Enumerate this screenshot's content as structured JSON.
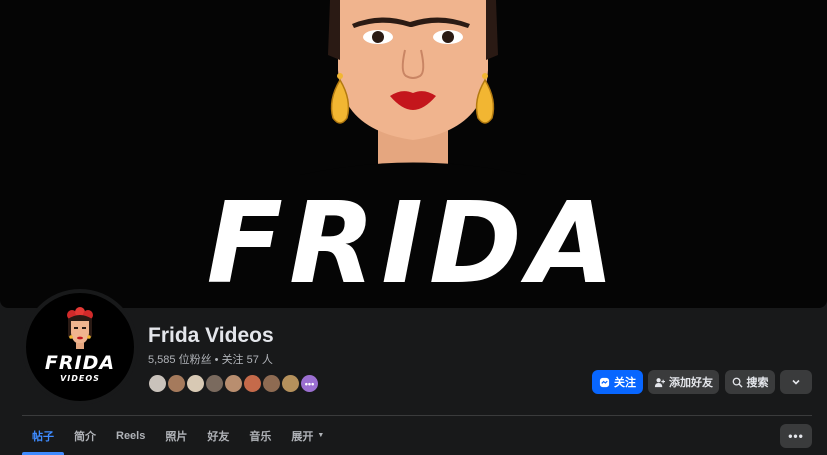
{
  "cover": {
    "word": "FRIDA"
  },
  "avatar": {
    "word": "FRIDA",
    "sub": "VIDEOS"
  },
  "profile": {
    "name": "Frida Videos",
    "followers": "5,585 位粉丝",
    "separator": " • ",
    "following": "关注 57 人"
  },
  "friends": {
    "more_label": "•••",
    "colors": [
      "#c9c2bb",
      "#a57a5c",
      "#d8c9b4",
      "#7a6a5e",
      "#b98e6f",
      "#c56a4a",
      "#8e6b52",
      "#b5915c",
      "#9b6fd1"
    ]
  },
  "actions": {
    "follow": {
      "label": "关注",
      "icon": "messenger-icon"
    },
    "add_friend": {
      "label": "添加好友",
      "icon": "add-person-icon"
    },
    "search": {
      "label": "搜索",
      "icon": "search-icon"
    },
    "expand": {
      "icon": "chevron-down-icon"
    }
  },
  "tabs": [
    {
      "label": "帖子"
    },
    {
      "label": "简介"
    },
    {
      "label": "Reels"
    },
    {
      "label": "照片"
    },
    {
      "label": "好友"
    },
    {
      "label": "音乐"
    },
    {
      "label": "展开"
    }
  ],
  "more_button": {
    "label": "•••"
  },
  "colors": {
    "accent": "#0866ff",
    "active_tab": "#3e8bff",
    "background": "#18191a"
  }
}
